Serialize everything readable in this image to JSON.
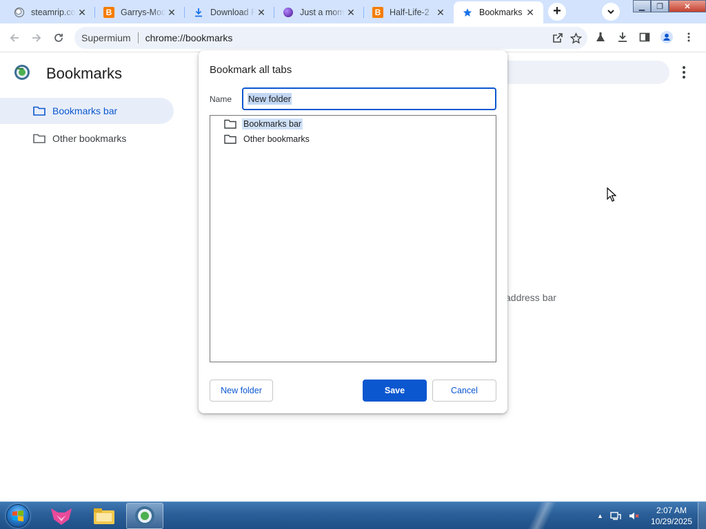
{
  "tabs": [
    {
      "title": "steamrip.com",
      "favicon": "globe-icon"
    },
    {
      "title": "Garrys-Mod",
      "favicon": "blogger-icon"
    },
    {
      "title": "Download File",
      "favicon": "download-icon"
    },
    {
      "title": "Just a moment...",
      "favicon": "purple-orb-icon"
    },
    {
      "title": "Half-Life-2",
      "favicon": "blogger-icon"
    },
    {
      "title": "Bookmarks",
      "favicon": "star-icon",
      "active": true
    }
  ],
  "toolbar": {
    "site_chip": "Supermium",
    "url": "chrome://bookmarks"
  },
  "bookmarks_page": {
    "title": "Bookmarks",
    "sidebar": [
      {
        "label": "Bookmarks bar",
        "selected": true
      },
      {
        "label": "Other bookmarks",
        "selected": false
      }
    ],
    "hint_fragment": "address bar"
  },
  "dialog": {
    "title": "Bookmark all tabs",
    "name_label": "Name",
    "name_value": "New folder",
    "tree": [
      {
        "label": "Bookmarks bar",
        "selected": true
      },
      {
        "label": "Other bookmarks",
        "selected": false
      }
    ],
    "new_folder_label": "New folder",
    "save_label": "Save",
    "cancel_label": "Cancel"
  },
  "taskbar": {
    "time": "2:07 AM",
    "date": "10/29/2025"
  },
  "colors": {
    "accent": "#0b57d0",
    "tabstrip": "#d3e3fd",
    "taskbar": "#2b5f98"
  }
}
